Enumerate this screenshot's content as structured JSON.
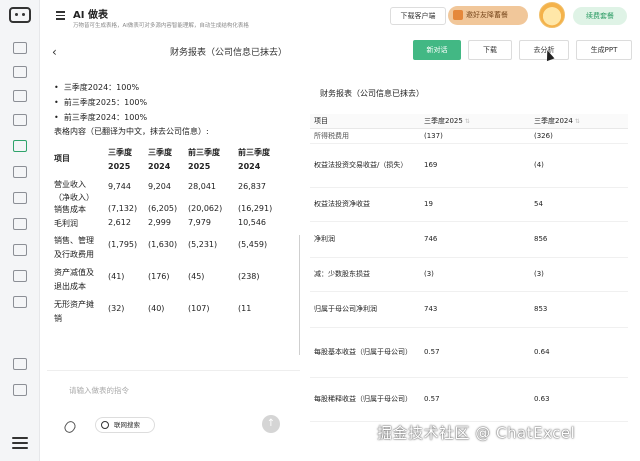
{
  "header": {
    "app_title": "AI 做表",
    "app_subtitle": "万物皆可生成表格，AI做表可对多源内容智能理解，自动生成结构化表格",
    "client_button": "下载客户端",
    "invite_button": "邀好友降蓄餐",
    "renew_button": "续费套餐"
  },
  "subbar": {
    "title": "财务报表（公司信息已抹去）",
    "new_chat": "新对话",
    "download": "下载",
    "analyze": "去分析",
    "generate_ppt": "生成PPT"
  },
  "chat": {
    "bullets": [
      "三季度2024：100%",
      "前三季度2025：100%",
      "前三季度2024：100%"
    ],
    "table_intro": "表格内容（已翻译为中文，抹去公司信息）:",
    "table": {
      "headers": [
        [
          "项目"
        ],
        [
          "三季度",
          "2025"
        ],
        [
          "三季度",
          "2024"
        ],
        [
          "前三季度",
          "2025"
        ],
        [
          "前三季度",
          "2024"
        ]
      ],
      "rows": [
        {
          "item": [
            "营业收入",
            "（净收入）"
          ],
          "values": [
            "9,744",
            "9,204",
            "28,041",
            "26,837"
          ]
        },
        {
          "item": [
            "销售成本"
          ],
          "values": [
            "(7,132)",
            "(6,205)",
            "(20,062)",
            "(16,291)"
          ]
        },
        {
          "item": [
            "毛利润"
          ],
          "values": [
            "2,612",
            "2,999",
            "7,979",
            "10,546"
          ]
        },
        {
          "item": [
            "销售、管理",
            "及行政费用"
          ],
          "values": [
            "(1,795)",
            "(1,630)",
            "(5,231)",
            "(5,459)"
          ]
        },
        {
          "item": [
            "资产减值及",
            "退出成本"
          ],
          "values": [
            "(41)",
            "(176)",
            "(45)",
            "(238)"
          ]
        },
        {
          "item": [
            "无形资产摊",
            "销"
          ],
          "values": [
            "(32)",
            "(40)",
            "(107)",
            "(11"
          ]
        }
      ]
    },
    "input_placeholder": "请输入做表的指令",
    "web_search": "联网搜索"
  },
  "right_panel": {
    "title": "财务报表（公司信息已抹去）",
    "columns": [
      "项目",
      "三季度2025",
      "三季度2024"
    ],
    "rows": [
      {
        "item": "所得税费用",
        "q3_2025": "(137)",
        "q3_2024": "(326)"
      },
      {
        "item": "权益法投资交易收益/（损失）",
        "q3_2025": "169",
        "q3_2024": "(4)"
      },
      {
        "item": "权益法投资净收益",
        "q3_2025": "19",
        "q3_2024": "54"
      },
      {
        "item": "净利润",
        "q3_2025": "746",
        "q3_2024": "856"
      },
      {
        "item": "减：少数股东损益",
        "q3_2025": "(3)",
        "q3_2024": "(3)"
      },
      {
        "item": "归属于母公司净利润",
        "q3_2025": "743",
        "q3_2024": "853"
      },
      {
        "item": "每股基本收益（归属于母公司）",
        "q3_2025": "0.57",
        "q3_2024": "0.64"
      },
      {
        "item": "每股稀释收益（归属于母公司）",
        "q3_2025": "0.57",
        "q3_2024": "0.63"
      }
    ]
  },
  "watermark": "掘金技术社区 @ ChatExcel",
  "colors": {
    "accent": "#42b884",
    "invite_bg": "#f1c79a",
    "renew_bg": "#dff3e6"
  },
  "icons": [
    "robot-logo-icon",
    "menu-icon",
    "back-arrow-icon",
    "gift-icon",
    "globe-icon",
    "paperclip-icon",
    "send-arrow-icon",
    "sort-icon"
  ]
}
